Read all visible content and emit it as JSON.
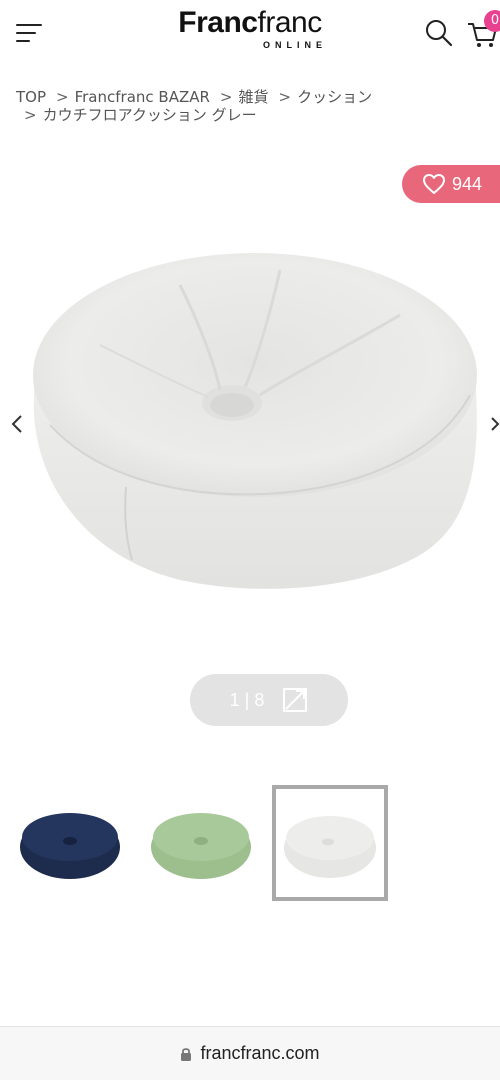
{
  "header": {
    "logo_bold": "Franc",
    "logo_light": "franc",
    "logo_sub": "ONLINE",
    "cart_count": "0"
  },
  "breadcrumb": {
    "items": [
      "TOP",
      "Francfranc BAZAR",
      "雑貨",
      "クッション",
      "カウチフロアクッション グレー"
    ],
    "separator": ">"
  },
  "favorite": {
    "count": "944",
    "color": "#e8677a"
  },
  "gallery": {
    "current": "1",
    "separator": "|",
    "total": "8",
    "thumbnails": [
      {
        "color": "navy",
        "hex": "#1d2b4d"
      },
      {
        "color": "green",
        "hex": "#9dbf8e"
      },
      {
        "color": "gray",
        "hex": "#e6e6e4",
        "selected": true
      }
    ]
  },
  "browser": {
    "url": "francfranc.com"
  },
  "icons": [
    "menu-icon",
    "search-icon",
    "cart-icon",
    "heart-icon",
    "chevron-left-icon",
    "chevron-right-icon",
    "expand-icon",
    "lock-icon"
  ]
}
